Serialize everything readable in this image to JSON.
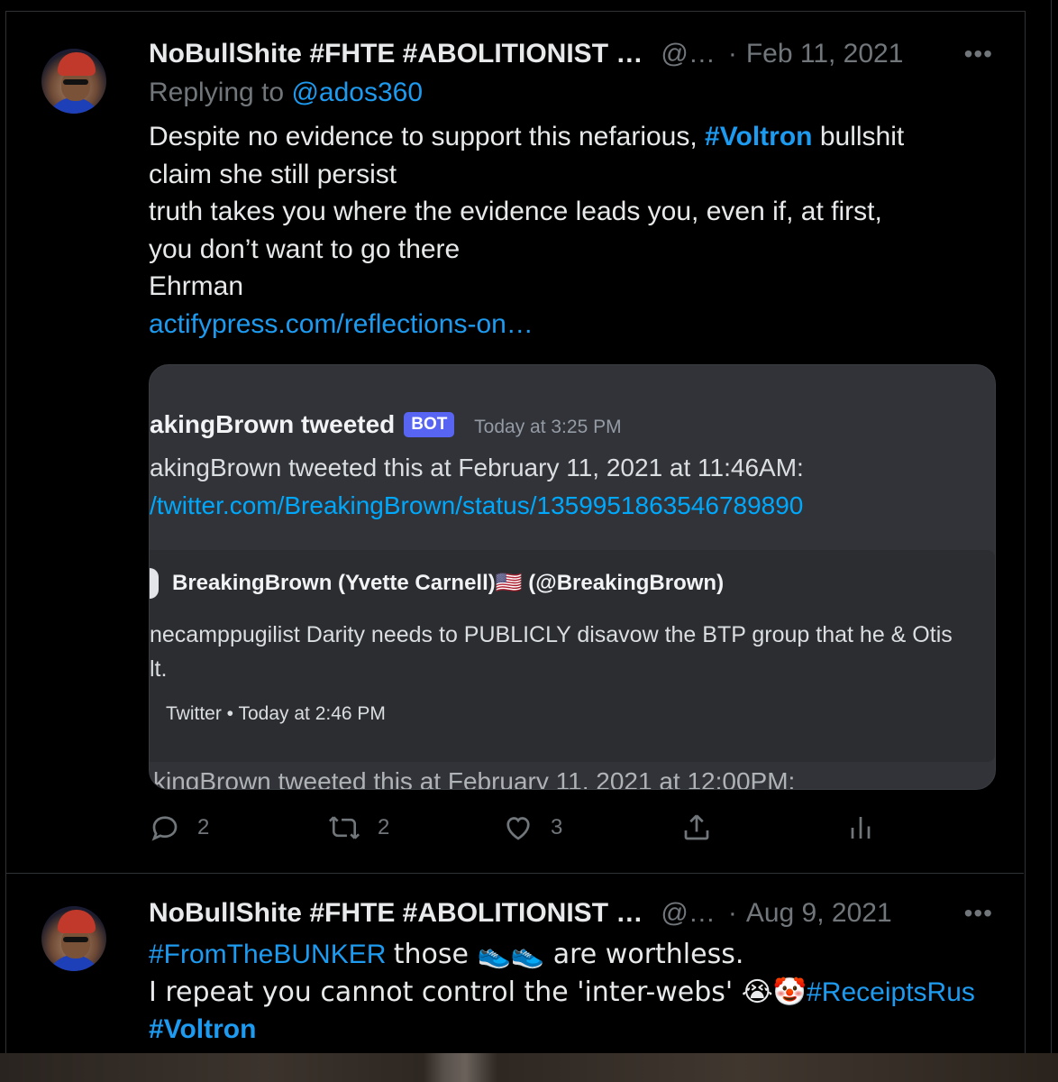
{
  "tweet1": {
    "name": "NoBullShite #FHTE #ABOLITIONIST …",
    "handle": "@…",
    "dot": "·",
    "date": "Feb 11, 2021",
    "more": "•••",
    "replying_prefix": "Replying to",
    "replying_handle": "@ados360",
    "line1_a": "Despite no evidence to support this nefarious,",
    "line1_hashtag": "#Voltron",
    "line1_b": "bullshit",
    "line2": "claim she still persist",
    "line3": "truth takes you where the evidence leads you, even if, at first,",
    "line4": "you don’t want to go there",
    "line5": "Ehrman",
    "link": "actifypress.com/reflections-on…",
    "card": {
      "title": "akingBrown tweeted",
      "badge": "BOT",
      "timestamp": "Today at 3:25 PM",
      "line1": "akingBrown tweeted this at February 11, 2021 at 11:46AM:",
      "url": "/twitter.com/BreakingBrown/status/1359951863546789890",
      "embed_author": "BreakingBrown (Yvette Carnell)🇺🇸  (@BreakingBrown)",
      "embed_text1": "necamppugilist Darity needs to PUBLICLY disavow the BTP group that he & Otis",
      "embed_text2": "lt.",
      "embed_footer": "Twitter • Today at 2:46 PM",
      "cut_line": "kingBrown tweeted this at February 11, 2021 at 12:00PM:"
    },
    "actions": {
      "replies": "2",
      "retweets": "2",
      "likes": "3"
    }
  },
  "tweet2": {
    "name": "NoBullShite #FHTE #ABOLITIONIST …",
    "handle": "@…",
    "dot": "·",
    "date": "Aug 9, 2021",
    "more": "•••",
    "line1_hashtag": "#FromTheBUNKER",
    "line1_text": "those 👟👟 are worthless.",
    "line2_text": "I repeat you cannot control the 'inter-webs' 😭🤡",
    "line2_hashtag": "#ReceiptsRus",
    "line3_hashtag": "#Voltron"
  },
  "colors": {
    "background": "#000000",
    "text": "#e7e9ea",
    "muted": "#71767b",
    "link": "#1d9bf0",
    "border": "#2f3336",
    "discord_bg": "#313338",
    "discord_embed": "#2b2d31",
    "discord_link": "#00a8fc",
    "bot_badge": "#5865f2"
  },
  "icons": [
    "reply-icon",
    "retweet-icon",
    "like-icon",
    "share-icon",
    "analytics-icon",
    "more-icon"
  ]
}
